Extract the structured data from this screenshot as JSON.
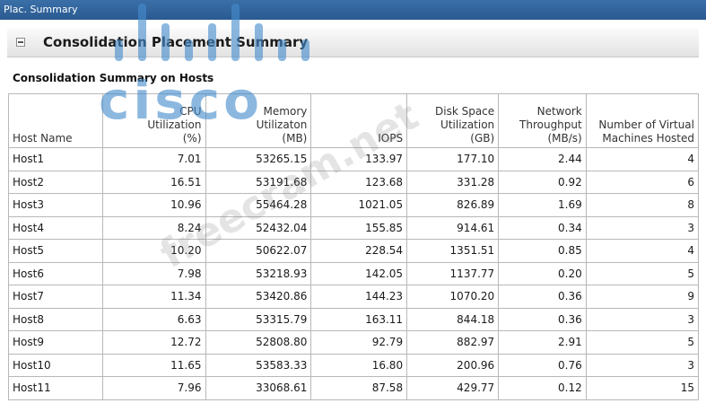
{
  "window": {
    "title": "Plac. Summary"
  },
  "section": {
    "title": "Consolidation Placement Summary"
  },
  "subtitle": "Consolidation Summary on Hosts",
  "watermarks": {
    "brand": "cisco",
    "site": "freecram.net"
  },
  "table": {
    "columns": [
      "Host Name",
      "CPU Utilization (%)",
      "Memory Utilizaton (MB)",
      "IOPS",
      "Disk Space Utilization (GB)",
      "Network Throughput (MB/s)",
      "Number of Virtual Machines Hosted"
    ],
    "rows": [
      [
        "Host1",
        "7.01",
        "53265.15",
        "133.97",
        "177.10",
        "2.44",
        "4"
      ],
      [
        "Host2",
        "16.51",
        "53191.68",
        "123.68",
        "331.28",
        "0.92",
        "6"
      ],
      [
        "Host3",
        "10.96",
        "55464.28",
        "1021.05",
        "826.89",
        "1.69",
        "8"
      ],
      [
        "Host4",
        "8.24",
        "52432.04",
        "155.85",
        "914.61",
        "0.34",
        "3"
      ],
      [
        "Host5",
        "10.20",
        "50622.07",
        "228.54",
        "1351.51",
        "0.85",
        "4"
      ],
      [
        "Host6",
        "7.98",
        "53218.93",
        "142.05",
        "1137.77",
        "0.20",
        "5"
      ],
      [
        "Host7",
        "11.34",
        "53420.86",
        "144.23",
        "1070.20",
        "0.36",
        "9"
      ],
      [
        "Host8",
        "6.63",
        "53315.79",
        "163.11",
        "844.18",
        "0.36",
        "3"
      ],
      [
        "Host9",
        "12.72",
        "52808.80",
        "92.79",
        "882.97",
        "2.91",
        "5"
      ],
      [
        "Host10",
        "11.65",
        "53583.33",
        "16.80",
        "200.96",
        "0.76",
        "3"
      ],
      [
        "Host11",
        "7.96",
        "33068.61",
        "87.58",
        "429.77",
        "0.12",
        "15"
      ]
    ]
  }
}
